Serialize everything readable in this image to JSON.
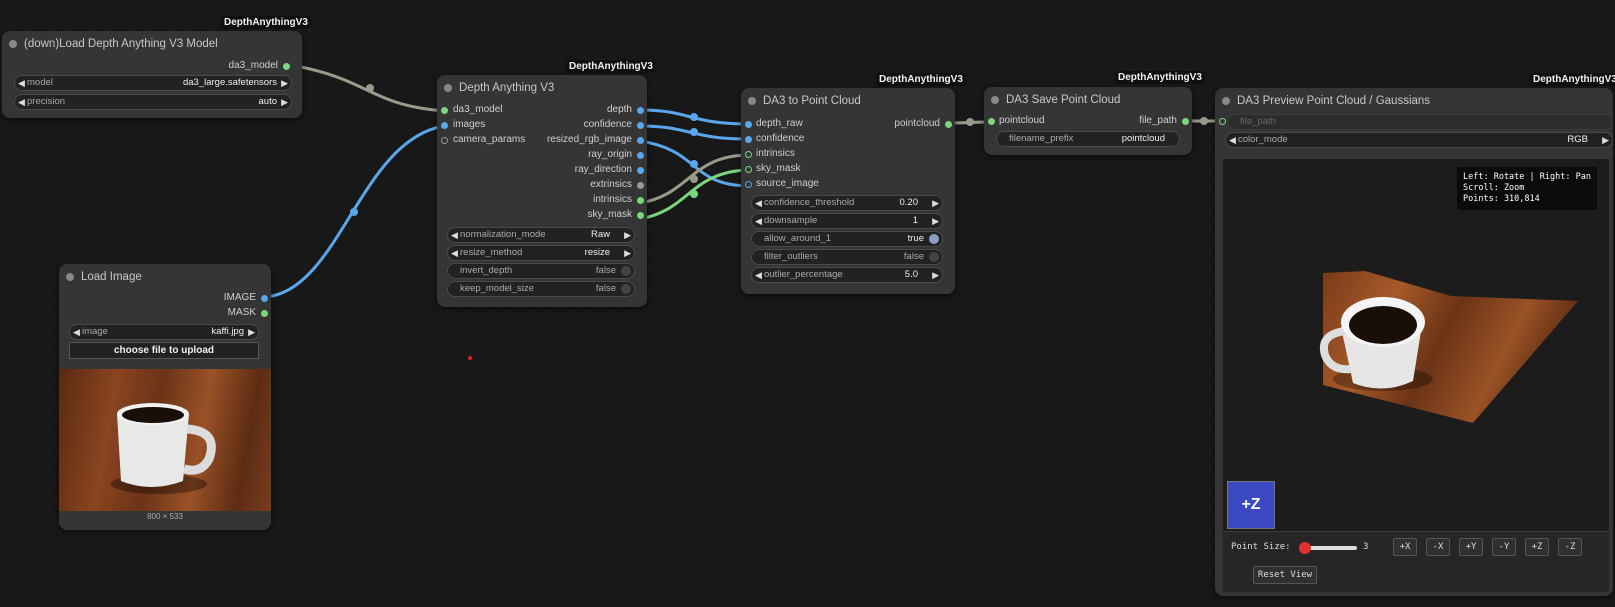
{
  "badge_text": "DepthAnythingV3",
  "model_node": {
    "title": "(down)Load Depth Anything V3 Model",
    "output": "da3_model",
    "widgets": [
      {
        "label": "model",
        "value": "da3_large.safetensors"
      },
      {
        "label": "precision",
        "value": "auto"
      }
    ]
  },
  "load_image_node": {
    "title": "Load Image",
    "outputs": [
      "IMAGE",
      "MASK"
    ],
    "image_widget": {
      "label": "image",
      "value": "kaffi.jpg"
    },
    "upload_button": "choose file to upload",
    "dimensions": "800 × 533"
  },
  "depth_node": {
    "title": "Depth Anything V3",
    "inputs": [
      "da3_model",
      "images",
      "camera_params"
    ],
    "outputs": [
      "depth",
      "confidence",
      "resized_rgb_image",
      "ray_origin",
      "ray_direction",
      "extrinsics",
      "intrinsics",
      "sky_mask"
    ],
    "widgets": [
      {
        "label": "normalization_mode",
        "value": "Raw"
      },
      {
        "label": "resize_method",
        "value": "resize"
      },
      {
        "label": "invert_depth",
        "value": "false"
      },
      {
        "label": "keep_model_size",
        "value": "false"
      }
    ]
  },
  "pointcloud_node": {
    "title": "DA3 to Point Cloud",
    "inputs": [
      "depth_raw",
      "confidence",
      "intrinsics",
      "sky_mask",
      "source_image"
    ],
    "output": "pointcloud",
    "widgets": [
      {
        "label": "confidence_threshold",
        "value": "0.20"
      },
      {
        "label": "downsample",
        "value": "1"
      },
      {
        "label": "allow_around_1",
        "value": "true"
      },
      {
        "label": "filter_outliers",
        "value": "false"
      },
      {
        "label": "outlier_percentage",
        "value": "5.0"
      }
    ]
  },
  "save_node": {
    "title": "DA3 Save Point Cloud",
    "input": "pointcloud",
    "output": "file_path",
    "widget": {
      "label": "filename_prefix",
      "value": "pointcloud"
    }
  },
  "preview_node": {
    "title": "DA3 Preview Point Cloud / Gaussians",
    "input_placeholder": "file_path",
    "color_mode": {
      "label": "color_mode",
      "value": "RGB"
    },
    "tooltip": "Left: Rotate | Right: Pan\nScroll: Zoom\nPoints: 310,814",
    "cube_face": "+Z",
    "point_size_label": "Point Size:",
    "point_size_value": "3",
    "axis_buttons": [
      "+X",
      "-X",
      "+Y",
      "-Y",
      "+Z",
      "-Z"
    ],
    "reset_button": "Reset View"
  },
  "colors": {
    "blue_link": "#5aa6ea",
    "green_link": "#7bd67e",
    "gray_link": "#9a9a8a",
    "node_bg": "#353535",
    "canvas": "#181818"
  }
}
